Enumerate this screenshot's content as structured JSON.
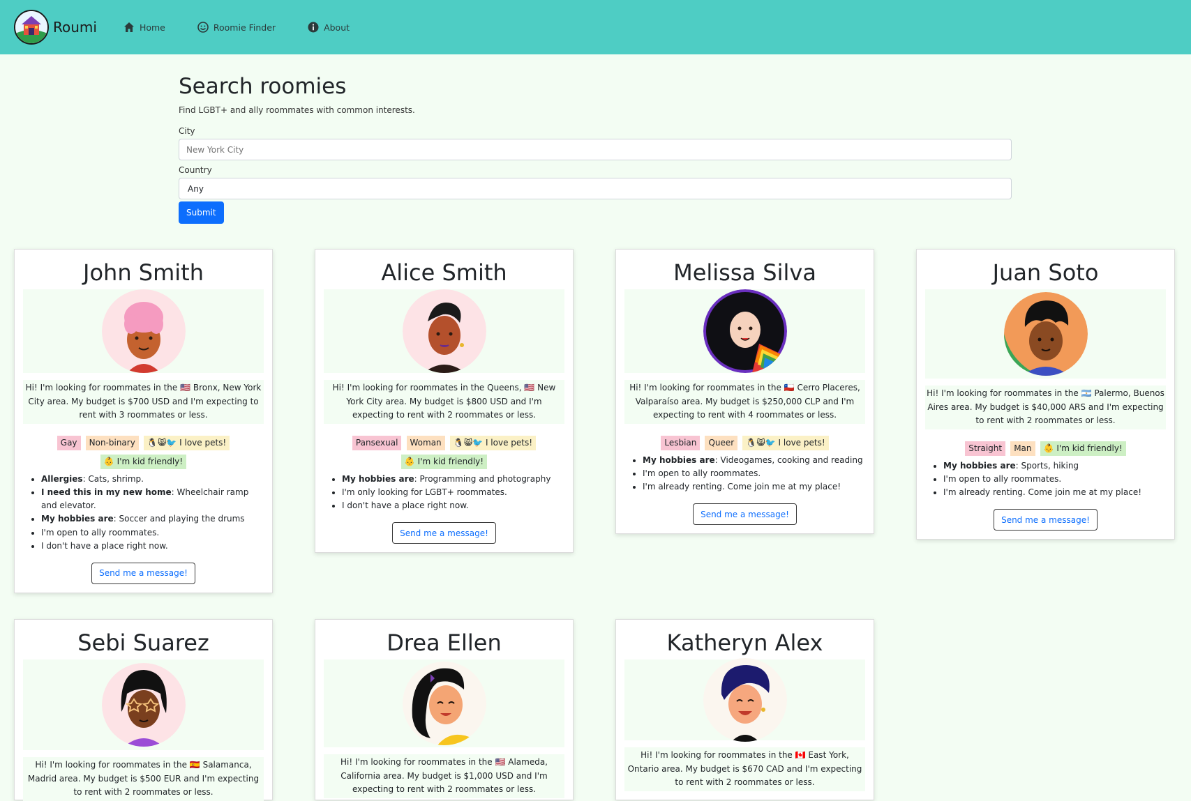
{
  "nav": {
    "brand": "Roumi",
    "links": [
      {
        "label": "Home",
        "icon": "home-icon"
      },
      {
        "label": "Roomie Finder",
        "icon": "smile-icon"
      },
      {
        "label": "About",
        "icon": "info-icon"
      }
    ]
  },
  "search": {
    "title": "Search roomies",
    "subtitle": "Find LGBT+ and ally roommates with common interests.",
    "city_label": "City",
    "city_placeholder": "New York City",
    "country_label": "Country",
    "country_value": "Any",
    "submit_label": "Submit"
  },
  "message_label": "Send me a message!",
  "cards": [
    {
      "name": "John Smith",
      "desc": "Hi! I'm looking for roommates in the 🇺🇸 Bronx, New York City area. My budget is $700 USD and I'm expecting to rent with 3 roommates or less.",
      "tags": [
        {
          "text": "Gay",
          "style": "pink"
        },
        {
          "text": "Non-binary",
          "style": "peach"
        },
        {
          "text": "🐧😸🐦 I love pets!",
          "style": "yellow"
        },
        {
          "text": "👶 I'm kid friendly!",
          "style": "green"
        }
      ],
      "list": [
        {
          "bold": "Allergies",
          "text": ": Cats, shrimp."
        },
        {
          "bold": "I need this in my new home",
          "text": ": Wheelchair ramp and elevator."
        },
        {
          "bold": "My hobbies are",
          "text": ": Soccer and playing the drums"
        },
        {
          "bold": "",
          "text": "I'm open to ally roommates."
        },
        {
          "bold": "",
          "text": "I don't have a place right now."
        }
      ]
    },
    {
      "name": "Alice Smith",
      "desc": "Hi! I'm looking for roommates in the Queens, 🇺🇸 New York City area. My budget is $800 USD and I'm expecting to rent with 2 roommates or less.",
      "tags": [
        {
          "text": "Pansexual",
          "style": "pink"
        },
        {
          "text": "Woman",
          "style": "peach"
        },
        {
          "text": "🐧😸🐦 I love pets!",
          "style": "yellow"
        },
        {
          "text": "👶 I'm kid friendly!",
          "style": "green"
        }
      ],
      "list": [
        {
          "bold": "My hobbies are",
          "text": ": Programming and photography"
        },
        {
          "bold": "",
          "text": "I'm only looking for LGBT+ roommates."
        },
        {
          "bold": "",
          "text": "I don't have a place right now."
        }
      ]
    },
    {
      "name": "Melissa Silva",
      "desc": "Hi! I'm looking for roommates in the 🇨🇱 Cerro Placeres, Valparaíso area. My budget is $250,000 CLP and I'm expecting to rent with 4 roommates or less.",
      "tags": [
        {
          "text": "Lesbian",
          "style": "pink"
        },
        {
          "text": "Queer",
          "style": "peach"
        },
        {
          "text": "🐧😸🐦 I love pets!",
          "style": "yellow"
        }
      ],
      "list": [
        {
          "bold": "My hobbies are",
          "text": ": Videogames, cooking and reading"
        },
        {
          "bold": "",
          "text": "I'm open to ally roommates."
        },
        {
          "bold": "",
          "text": "I'm already renting. Come join me at my place!"
        }
      ]
    },
    {
      "name": "Juan Soto",
      "desc": "Hi! I'm looking for roommates in the 🇦🇷 Palermo, Buenos Aires area. My budget is $40,000 ARS and I'm expecting to rent with 2 roommates or less.",
      "tags": [
        {
          "text": "Straight",
          "style": "pink"
        },
        {
          "text": "Man",
          "style": "peach"
        },
        {
          "text": "👶 I'm kid friendly!",
          "style": "green"
        }
      ],
      "list": [
        {
          "bold": "My hobbies are",
          "text": ": Sports, hiking"
        },
        {
          "bold": "",
          "text": "I'm open to ally roommates."
        },
        {
          "bold": "",
          "text": "I'm already renting. Come join me at my place!"
        }
      ]
    },
    {
      "name": "Sebi Suarez",
      "desc": "Hi! I'm looking for roommates in the 🇪🇸 Salamanca, Madrid area. My budget is $500 EUR and I'm expecting to rent with 2 roommates or less.",
      "tags": [],
      "list": []
    },
    {
      "name": "Drea Ellen",
      "desc": "Hi! I'm looking for roommates in the 🇺🇸 Alameda, California area. My budget is $1,000 USD and I'm expecting to rent with 2 roommates or less.",
      "tags": [],
      "list": []
    },
    {
      "name": "Katheryn Alex",
      "desc": "Hi! I'm looking for roommates in the 🇨🇦 East York, Ontario area. My budget is $670 CAD and I'm expecting to rent with 2 roommates or less.",
      "tags": [],
      "list": []
    }
  ]
}
